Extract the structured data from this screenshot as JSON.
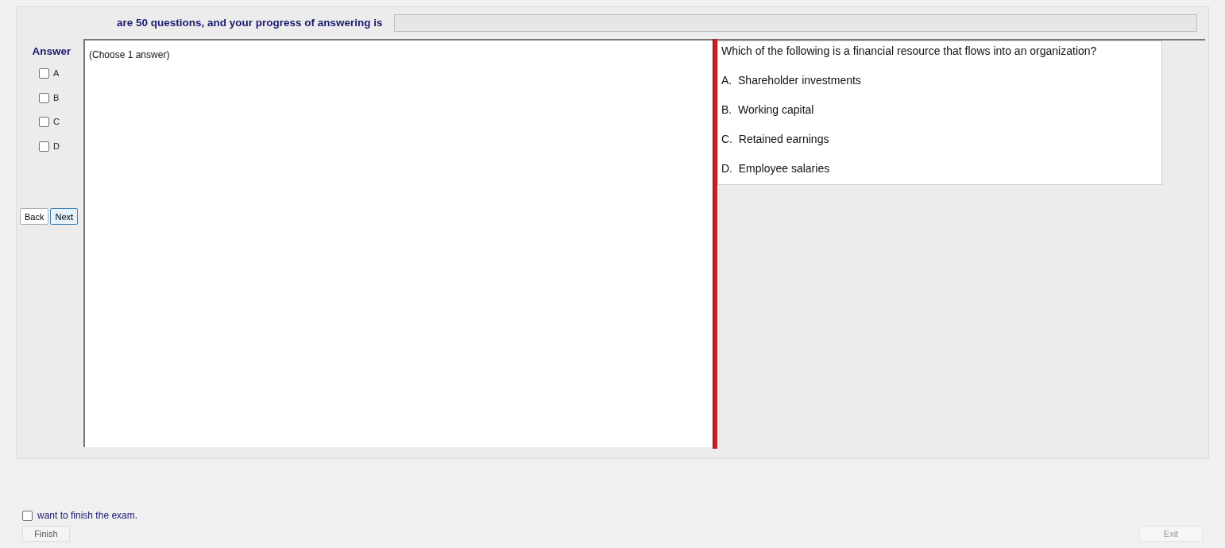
{
  "header": {
    "text": "are 50 questions, and your progress of answering is"
  },
  "progress": {
    "level": 0
  },
  "answer_panel": {
    "title": "Answer",
    "options": [
      {
        "label": "A",
        "checked": false
      },
      {
        "label": "B",
        "checked": false
      },
      {
        "label": "C",
        "checked": false
      },
      {
        "label": "D",
        "checked": false
      }
    ]
  },
  "nav_buttons": [
    {
      "label": "Back",
      "focused": false
    },
    {
      "label": "Next",
      "focused": true
    }
  ],
  "answer_area": {
    "hint": "(Choose 1 answer)"
  },
  "question": {
    "text": "Which of the following is a financial resource that flows into an organization?",
    "choices": [
      {
        "letter": "A.",
        "text": "Shareholder investments"
      },
      {
        "letter": "B.",
        "text": "Working capital"
      },
      {
        "letter": "C.",
        "text": "Retained earnings"
      },
      {
        "letter": "D.",
        "text": "Employee salaries"
      }
    ]
  },
  "finish": {
    "label": "want to finish the exam.",
    "checked": false,
    "button": "Finish"
  },
  "exit_button": {
    "label": "Exit",
    "disabled": true
  }
}
